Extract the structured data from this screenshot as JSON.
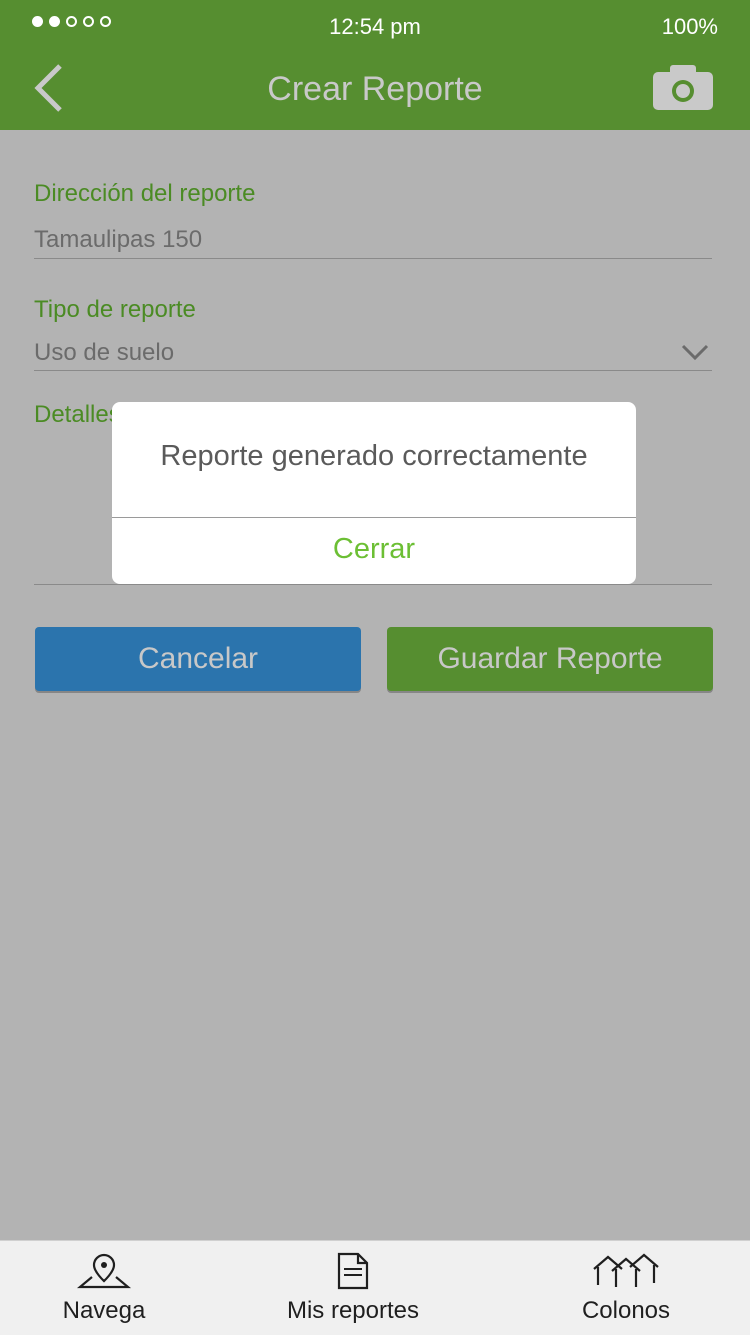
{
  "status": {
    "time": "12:54 pm",
    "battery": "100%",
    "signal_dots_filled": 2,
    "signal_dots_total": 5
  },
  "header": {
    "title": "Crear Reporte",
    "back_icon": "chevron-left-icon",
    "camera_icon": "camera-icon"
  },
  "form": {
    "address_label": "Dirección del reporte",
    "address_value": "Tamaulipas 150",
    "type_label": "Tipo de reporte",
    "type_value": "Uso de suelo",
    "details_label": "Detalles"
  },
  "buttons": {
    "cancel": "Cancelar",
    "save": "Guardar Reporte"
  },
  "dialog": {
    "message": "Reporte generado correctamente",
    "close": "Cerrar"
  },
  "tabs": [
    {
      "label": "Navega",
      "icon": "map-pin-icon"
    },
    {
      "label": "Mis reportes",
      "icon": "document-icon"
    },
    {
      "label": "Colonos",
      "icon": "houses-icon"
    }
  ],
  "colors": {
    "brand_green": "#568e30",
    "accent_green": "#6cbf34",
    "cancel_blue": "#2b74ad",
    "overlay": "#b3b3b3"
  }
}
